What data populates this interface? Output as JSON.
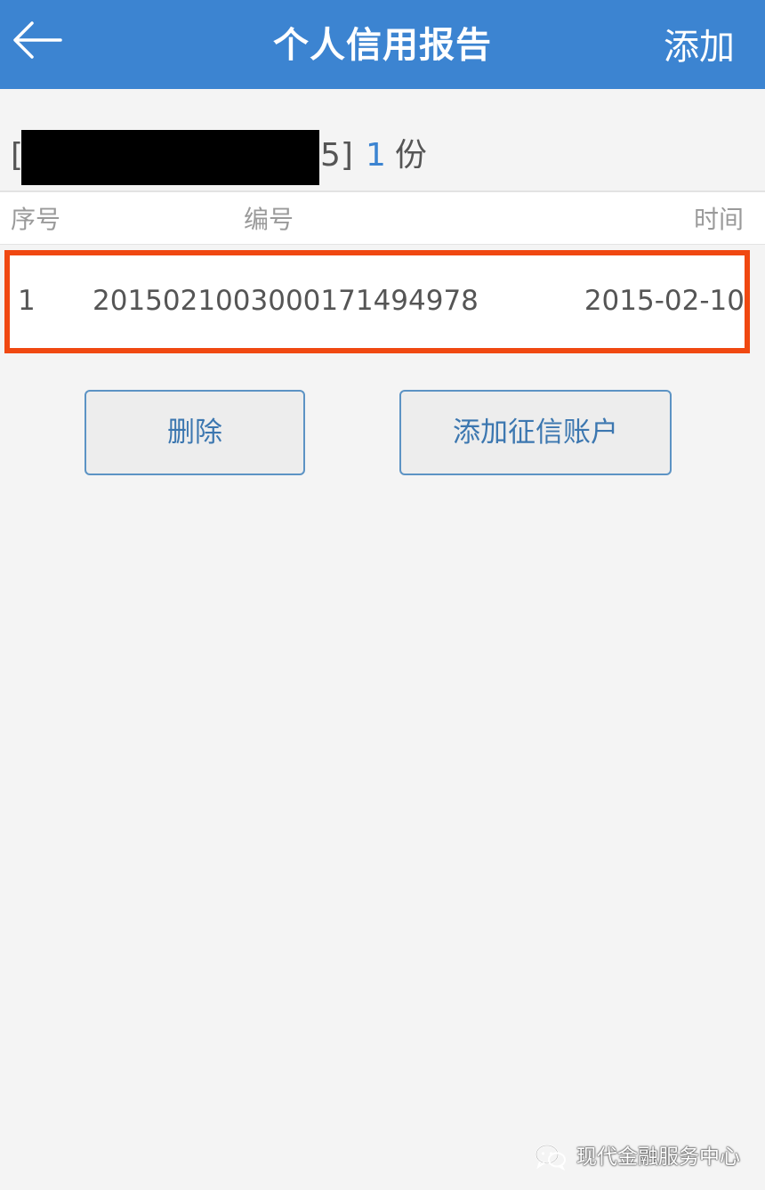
{
  "header": {
    "back_icon": "arrow-left-icon",
    "title": "个人信用报告",
    "add_label": "添加"
  },
  "summary": {
    "name_fragment": "[",
    "name_tail": "5]",
    "count": "1",
    "unit": "份"
  },
  "table": {
    "columns": [
      "序号",
      "编号",
      "时间"
    ],
    "rows": [
      {
        "index": "1",
        "number": "2015021003000171494978",
        "time": "2015-02-10"
      }
    ]
  },
  "actions": {
    "delete_label": "删除",
    "add_account_label": "添加征信账户"
  },
  "watermark": {
    "icon": "wechat-icon",
    "text": "现代金融服务中心"
  },
  "colors": {
    "nav_bar": "#3c84d1",
    "highlight_border": "#f04811",
    "button_text": "#3c77b0",
    "background": "#f4f4f4"
  }
}
